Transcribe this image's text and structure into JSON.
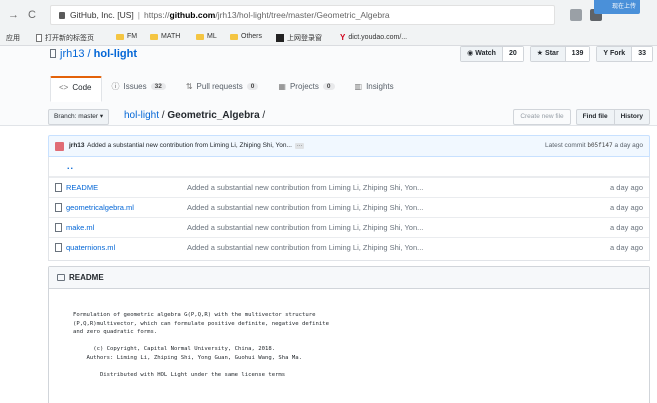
{
  "browser": {
    "back": "→",
    "reload": "C",
    "site_label": "GitHub, Inc. [US]",
    "separator": "|",
    "url_scheme": "https://",
    "url_host": "github.com",
    "url_path": "/jrh13/hol-light/tree/master/Geometric_Algebra",
    "corner_label": "现在上传"
  },
  "bookmarks": [
    {
      "label": "应用",
      "icon": "apps-icon"
    },
    {
      "label": "打开新的标签页",
      "icon": "page-icon"
    },
    {
      "label": "FM",
      "icon": "folder-icon"
    },
    {
      "label": "MATH",
      "icon": "folder-icon"
    },
    {
      "label": "ML",
      "icon": "folder-icon"
    },
    {
      "label": "Others",
      "icon": "folder-icon"
    },
    {
      "label": "上网登录窗",
      "icon": "square-icon"
    },
    {
      "label": "dict.youdao.com/...",
      "icon": "youdao-icon"
    }
  ],
  "repo": {
    "owner": "jrh13",
    "slash": " / ",
    "name": "hol-light",
    "watch": {
      "label": "Watch",
      "count": "20"
    },
    "star": {
      "label": "Star",
      "count": "139"
    },
    "fork": {
      "label": "Fork",
      "count": "33"
    }
  },
  "tabs": [
    {
      "label": "Code",
      "icon": "<>",
      "count": ""
    },
    {
      "label": "Issues",
      "icon": "ⓘ",
      "count": "32"
    },
    {
      "label": "Pull requests",
      "icon": "⇅",
      "count": "0"
    },
    {
      "label": "Projects",
      "icon": "▦",
      "count": "0"
    },
    {
      "label": "Insights",
      "icon": "▥",
      "count": ""
    }
  ],
  "filenav": {
    "branch_label": "Branch: master ▾",
    "repo_link": "hol-light",
    "crumb_sep": " / ",
    "current_dir": "Geometric_Algebra",
    "trailing": " /",
    "create_new": "Create new file",
    "find_file": "Find file",
    "history": "History"
  },
  "commit": {
    "author": "jrh13",
    "message": "Added a substantial new contribution from Liming Li, Zhiping Shi, Yon...",
    "ellipsis": "···",
    "latest_label": "Latest commit",
    "sha": "b05f147",
    "age": "a day ago"
  },
  "files": {
    "parent": "..",
    "rows": [
      {
        "name": "README",
        "message": "Added a substantial new contribution from Liming Li, Zhiping Shi, Yon...",
        "age": "a day ago"
      },
      {
        "name": "geometricalgebra.ml",
        "message": "Added a substantial new contribution from Liming Li, Zhiping Shi, Yon...",
        "age": "a day ago"
      },
      {
        "name": "make.ml",
        "message": "Added a substantial new contribution from Liming Li, Zhiping Shi, Yon...",
        "age": "a day ago"
      },
      {
        "name": "quaternions.ml",
        "message": "Added a substantial new contribution from Liming Li, Zhiping Shi, Yon...",
        "age": "a day ago"
      }
    ]
  },
  "readme": {
    "title": "README",
    "body": "Formulation of geometric algebra G(P,Q,R) with the multivector structure\n(P,Q,R)multivector, which can formulate positive definite, negative definite\nand zero quadratic forms.\n\n      (c) Copyright, Capital Normal University, China, 2018.\n    Authors: Liming Li, Zhiping Shi, Yong Guan, Guohui Wang, Sha Ma.\n\n        Distributed with HOL Light under the same license terms"
  }
}
